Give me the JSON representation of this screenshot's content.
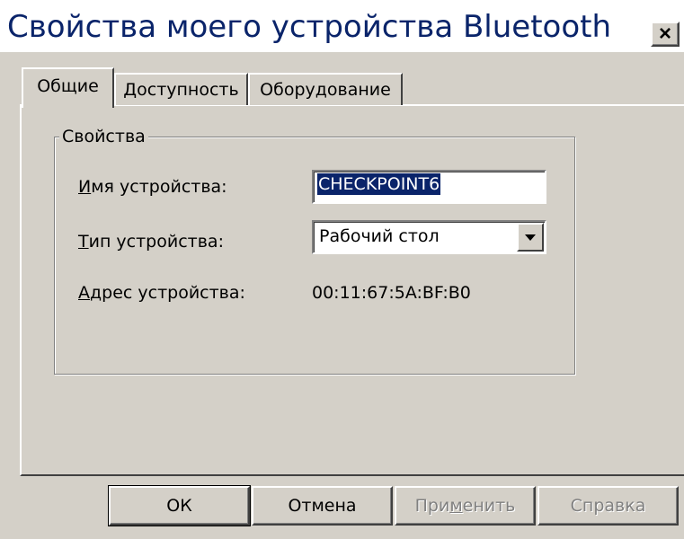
{
  "window": {
    "title": "Свойства моего устройства Bluetooth",
    "close_label": "×"
  },
  "tabs": [
    {
      "label": "Общие",
      "active": true
    },
    {
      "label": "Доступность",
      "active": false
    },
    {
      "label": "Оборудование",
      "active": false
    }
  ],
  "properties_group": {
    "label": "Свойства",
    "device_name": {
      "label_prefix": "И",
      "label_rest": "мя устройства:",
      "value": "CHECKPOINT6"
    },
    "device_type": {
      "label_prefix": "Т",
      "label_rest": "ип устройства:",
      "selected": "Рабочий стол"
    },
    "device_address": {
      "label_prefix": "А",
      "label_rest": "дрес устройства:",
      "value": "00:11:67:5A:BF:B0"
    }
  },
  "buttons": {
    "ok": "ОК",
    "cancel": "Отмена",
    "apply_prefix": "При",
    "apply_underlined": "м",
    "apply_rest": "енить",
    "help": "Справка"
  },
  "colors": {
    "title_text": "#0a246a",
    "selection": "#0a246a",
    "face": "#d4d0c8",
    "disabled_text": "#808080"
  },
  "icons": {
    "close": "close-icon",
    "dropdown": "chevron-down-icon"
  }
}
